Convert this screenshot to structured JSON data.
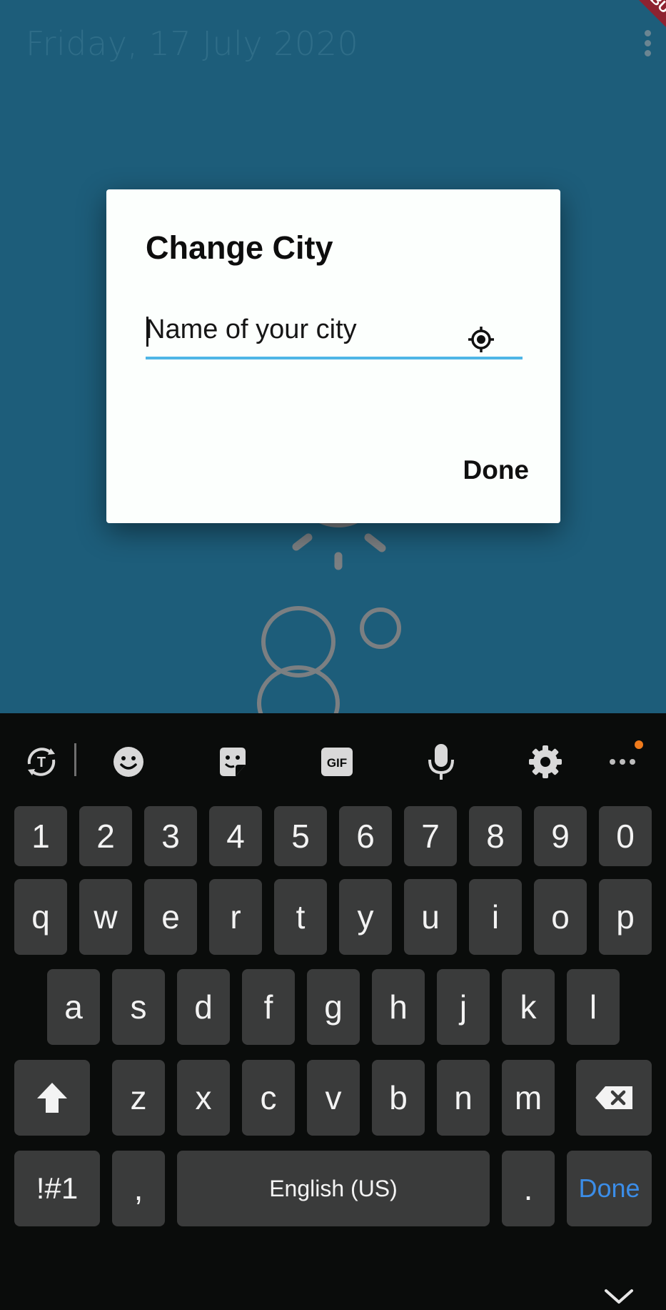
{
  "app": {
    "date": "Friday, 17 July 2020",
    "debug_banner": "DEBUG",
    "menu_icon": "more-vert-icon"
  },
  "dialog": {
    "title": "Change City",
    "input_placeholder": "Name of your city",
    "input_value": "",
    "locate_icon": "gps-fixed-icon",
    "done_label": "Done"
  },
  "keyboard": {
    "toolbar_icons": [
      "translate-icon",
      "emoji-icon",
      "sticker-icon",
      "gif-icon",
      "mic-icon",
      "settings-icon",
      "more-horiz-icon"
    ],
    "gif_label": "GIF",
    "number_row": [
      "1",
      "2",
      "3",
      "4",
      "5",
      "6",
      "7",
      "8",
      "9",
      "0"
    ],
    "row1": [
      "q",
      "w",
      "e",
      "r",
      "t",
      "y",
      "u",
      "i",
      "o",
      "p"
    ],
    "row2": [
      "a",
      "s",
      "d",
      "f",
      "g",
      "h",
      "j",
      "k",
      "l"
    ],
    "row3": [
      "z",
      "x",
      "c",
      "v",
      "b",
      "n",
      "m"
    ],
    "symbols_label": "!#1",
    "comma_label": ",",
    "space_label": "English (US)",
    "period_label": ".",
    "done_label": "Done",
    "accent_color": "#3b8de8",
    "notification_dot_color": "#f07b1c"
  }
}
